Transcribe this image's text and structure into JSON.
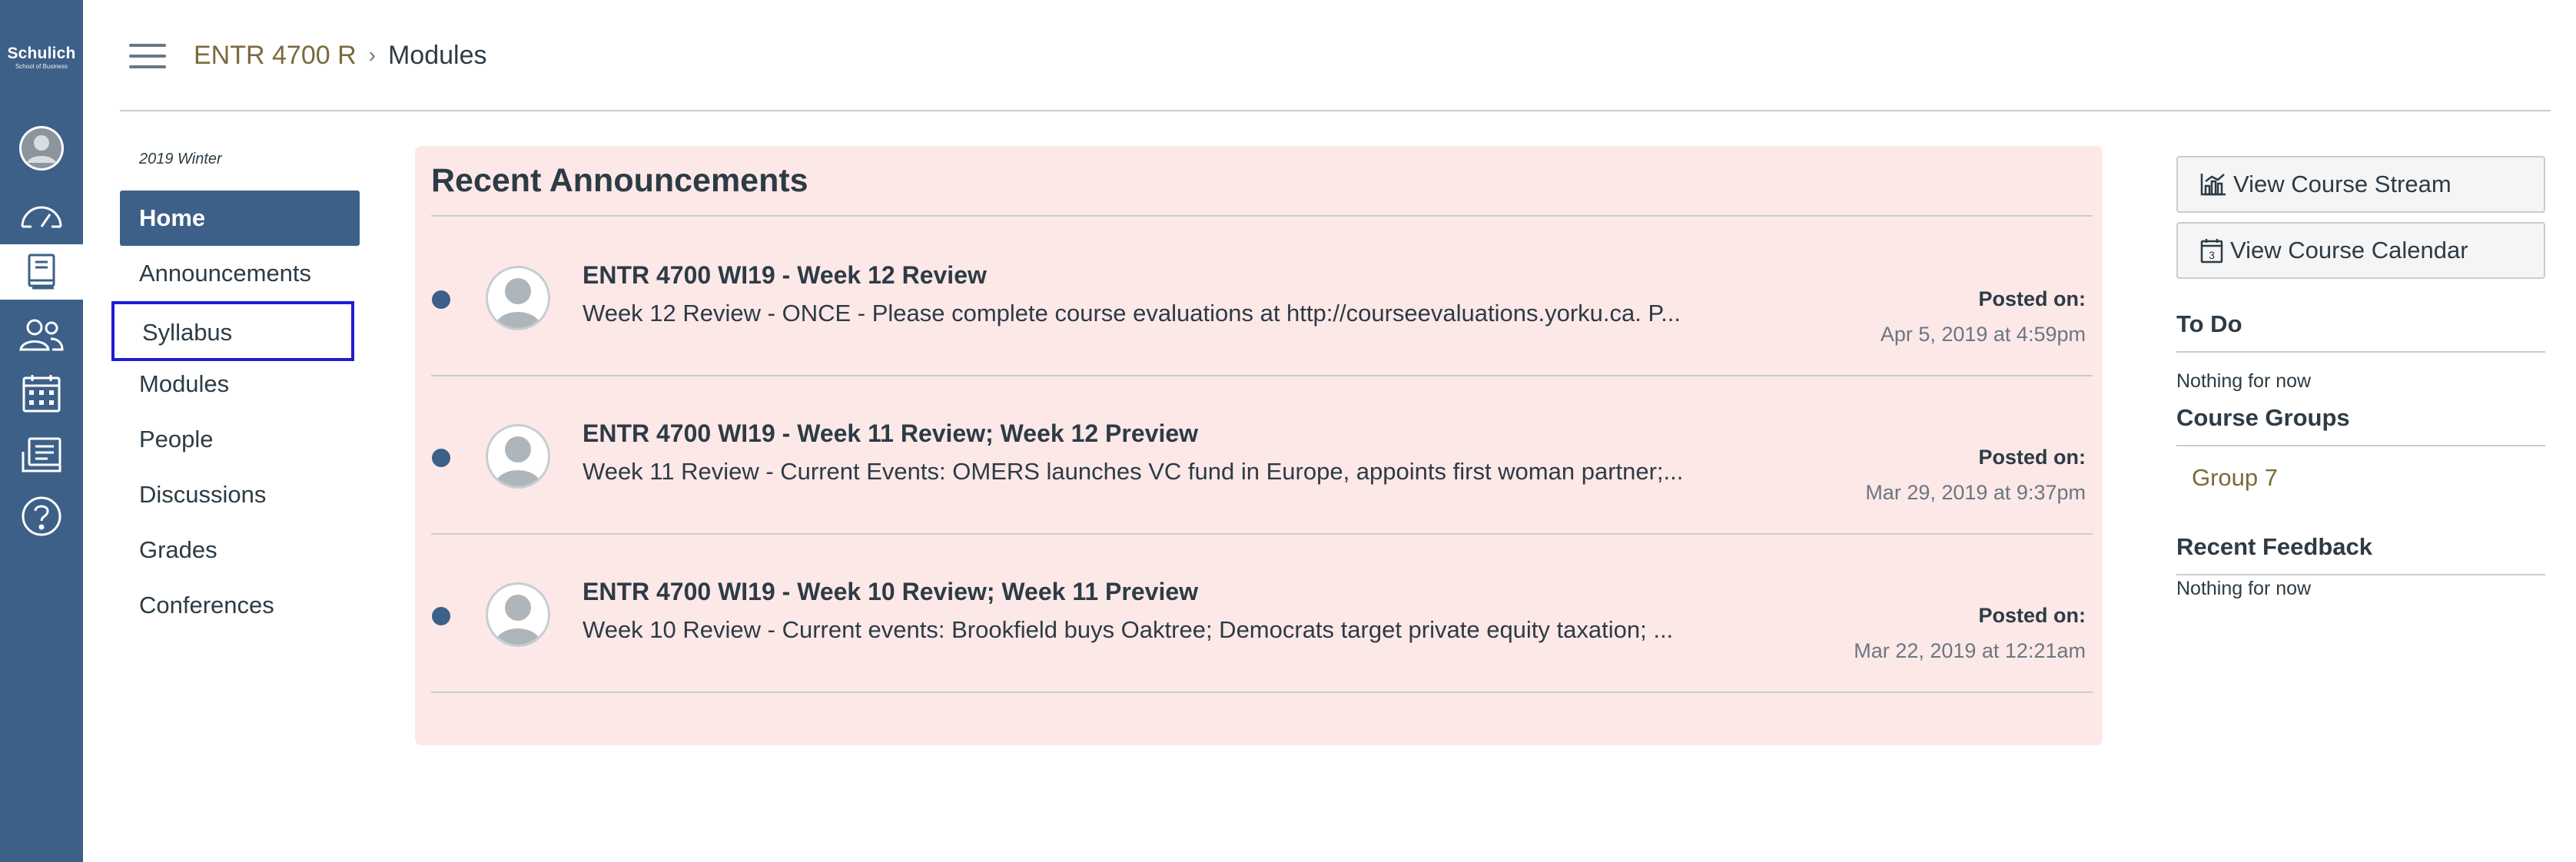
{
  "global_nav": {
    "logo_line1": "Schulich",
    "logo_line2": "School of Business",
    "items": [
      {
        "icon": "account-avatar-icon"
      },
      {
        "icon": "dashboard-icon"
      },
      {
        "icon": "courses-icon",
        "active": true
      },
      {
        "icon": "groups-icon"
      },
      {
        "icon": "calendar-icon"
      },
      {
        "icon": "inbox-icon"
      },
      {
        "icon": "help-icon"
      }
    ]
  },
  "header": {
    "menu_icon": "hamburger-menu-icon",
    "breadcrumb_course": "ENTR 4700 R",
    "breadcrumb_separator": "›",
    "breadcrumb_current": "Modules"
  },
  "course_nav": {
    "term": "2019 Winter",
    "items": [
      {
        "label": "Home",
        "active": true
      },
      {
        "label": "Announcements"
      },
      {
        "label": "Syllabus",
        "focused": true
      },
      {
        "label": "Modules"
      },
      {
        "label": "People"
      },
      {
        "label": "Discussions"
      },
      {
        "label": "Grades"
      },
      {
        "label": "Conferences"
      }
    ]
  },
  "announcements": {
    "heading": "Recent Announcements",
    "items": [
      {
        "title": "ENTR 4700 WI19 - Week 12 Review",
        "message": "Week 12 Review - ONCE - Please complete course evaluations at http://courseevaluations.yorku.ca.  P...",
        "posted_label": "Posted on:",
        "posted_date": "Apr 5, 2019 at 4:59pm"
      },
      {
        "title": "ENTR 4700 WI19 - Week 11 Review; Week 12 Preview",
        "message": "Week 11 Review - Current Events: OMERS launches VC fund in Europe, appoints first woman partner;...",
        "posted_label": "Posted on:",
        "posted_date": "Mar 29, 2019 at 9:37pm"
      },
      {
        "title": "ENTR 4700 WI19 - Week 10 Review; Week 11 Preview",
        "message": "Week 10 Review - Current events: Brookfield buys Oaktree; Democrats target private equity taxation; ...",
        "posted_label": "Posted on:",
        "posted_date": "Mar 22, 2019 at 12:21am"
      }
    ]
  },
  "sidebar": {
    "stream_button": "View Course Stream",
    "calendar_button": "View Course Calendar",
    "todo_heading": "To Do",
    "todo_text": "Nothing for now",
    "groups_heading": "Course Groups",
    "group_link": "Group 7",
    "feedback_heading": "Recent Feedback",
    "feedback_text": "Nothing for now"
  },
  "colors": {
    "nav_blue": "#3c6088",
    "announcement_bg": "#fde8e8",
    "link_brown": "#7a6a3c",
    "focus_ring": "#1f1fd1"
  }
}
